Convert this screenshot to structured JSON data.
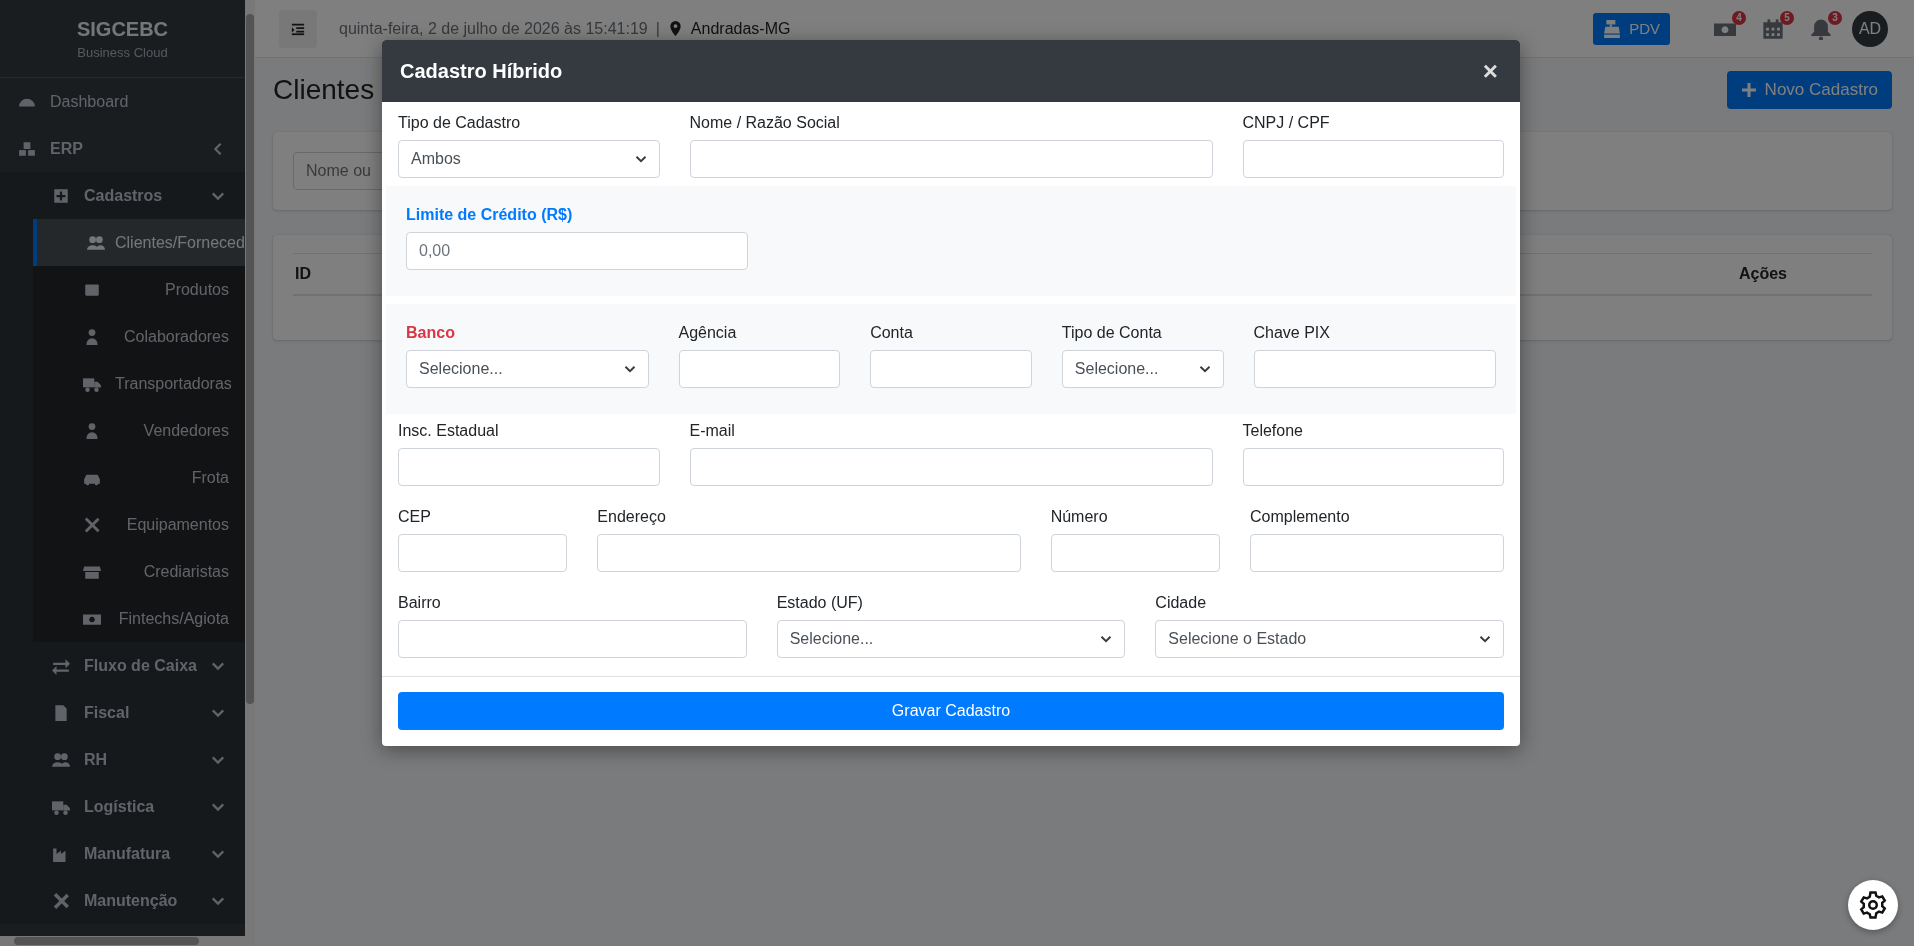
{
  "sidebar": {
    "brand": "SIGCEBC",
    "tagline": "Business Cloud",
    "items": [
      {
        "label": "Dashboard"
      },
      {
        "label": "ERP",
        "children": [
          {
            "label": "Cadastros",
            "children": [
              {
                "label": "Clientes/Forneced",
                "selected": true
              },
              {
                "label": "Produtos",
                "selected": false
              },
              {
                "label": "Colaboradores",
                "selected": false
              },
              {
                "label": "Transportadoras",
                "selected": false
              },
              {
                "label": "Vendedores",
                "selected": false
              },
              {
                "label": "Frota",
                "selected": false
              },
              {
                "label": "Equipamentos",
                "selected": false
              },
              {
                "label": "Crediaristas",
                "selected": false
              },
              {
                "label": "Fintechs/Agiota",
                "selected": false
              }
            ]
          },
          {
            "label": "Fluxo de Caixa"
          },
          {
            "label": "Fiscal"
          },
          {
            "label": "RH"
          },
          {
            "label": "Logística"
          },
          {
            "label": "Manufatura"
          },
          {
            "label": "Manutenção"
          }
        ]
      }
    ]
  },
  "topbar": {
    "datetime": "quinta-feira, 2 de julho de 2026 às 15:41:19",
    "separator": "|",
    "location": "Andradas-MG",
    "pdv": "PDV",
    "badges": [
      "4",
      "5",
      "3"
    ],
    "avatar": "AD"
  },
  "page": {
    "title": "Clientes",
    "new_button": "Novo Cadastro",
    "search": {
      "placeholder": "Nome ou"
    },
    "table": {
      "columns": [
        "ID",
        "Ações"
      ]
    }
  },
  "modal": {
    "title": "Cadastro Híbrido",
    "close": "×",
    "sections": [
      {
        "kind": "plain",
        "rows": [
          [
            {
              "label": "Tipo de Cadastro",
              "kind": "select",
              "value": "Ambos"
            },
            {
              "label": "Nome / Razão Social",
              "kind": "input"
            },
            {
              "label": "CNPJ / CPF",
              "kind": "input"
            }
          ]
        ]
      },
      {
        "kind": "shaded",
        "rows": [
          [
            {
              "label": "Limite de Crédito (R$)",
              "kind": "input",
              "placeholder": "0,00",
              "color": "#007bff"
            }
          ]
        ]
      },
      {
        "kind": "shaded",
        "rows": [
          [
            {
              "label": "Banco",
              "kind": "select",
              "value": "Selecione...",
              "color": "#dc3545"
            },
            {
              "label": "Agência",
              "kind": "input"
            },
            {
              "label": "Conta",
              "kind": "input"
            },
            {
              "label": "Tipo de Conta",
              "kind": "select",
              "value": "Selecione..."
            },
            {
              "label": "Chave PIX",
              "kind": "input"
            }
          ]
        ]
      },
      {
        "kind": "plain",
        "rows": [
          [
            {
              "label": "Insc. Estadual",
              "kind": "input"
            },
            {
              "label": "E-mail",
              "kind": "input"
            },
            {
              "label": "Telefone",
              "kind": "input"
            }
          ],
          [
            {
              "label": "CEP",
              "kind": "input"
            },
            {
              "label": "Endereço",
              "kind": "input"
            },
            {
              "label": "Número",
              "kind": "input"
            },
            {
              "label": "Complemento",
              "kind": "input"
            }
          ],
          [
            {
              "label": "Bairro",
              "kind": "input"
            },
            {
              "label": "Estado (UF)",
              "kind": "select",
              "value": "Selecione..."
            },
            {
              "label": "Cidade",
              "kind": "select",
              "value": "Selecione o Estado"
            }
          ]
        ]
      }
    ],
    "submit": "Gravar Cadastro"
  }
}
